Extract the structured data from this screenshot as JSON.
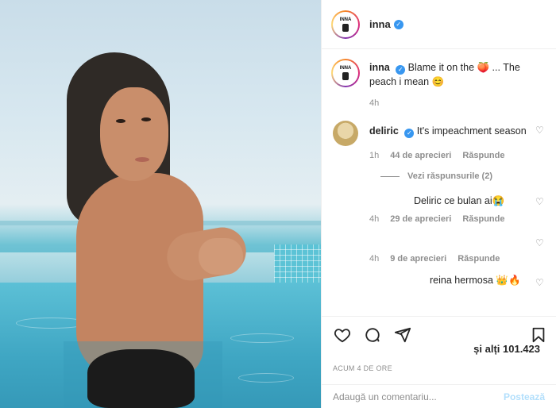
{
  "post": {
    "username": "inna",
    "avatar_text": "INNA",
    "caption": {
      "username": "inna",
      "text": "Blame it on the 🍑 ... The peach i mean 😊",
      "time": "4h"
    }
  },
  "comments": [
    {
      "username": "deliric",
      "text": "It's impeachment season",
      "time": "1h",
      "likes": "44 de aprecieri",
      "reply_label": "Răspunde",
      "view_replies": "Vezi răspunsurile (2)"
    }
  ],
  "replies": [
    {
      "text": "Deliric ce bulan ai😭",
      "time": "4h",
      "likes": "29 de aprecieri",
      "reply_label": "Răspunde"
    },
    {
      "text": "",
      "time": "4h",
      "likes": "9 de aprecieri",
      "reply_label": "Răspunde"
    },
    {
      "text": "reina hermosa 👑🔥",
      "time": "",
      "likes": "",
      "reply_label": ""
    }
  ],
  "likes_summary": "și alți 101.423",
  "posted_ago": "ACUM 4 DE ORE",
  "comment_input": {
    "placeholder": "Adaugă un comentariu...",
    "post_label": "Postează"
  },
  "colors": {
    "verified": "#3897f0",
    "muted": "#8e8e8e",
    "post_button": "#b2dffc"
  },
  "icons": [
    "verified-icon",
    "heart-icon",
    "comment-icon",
    "share-icon",
    "bookmark-icon"
  ]
}
